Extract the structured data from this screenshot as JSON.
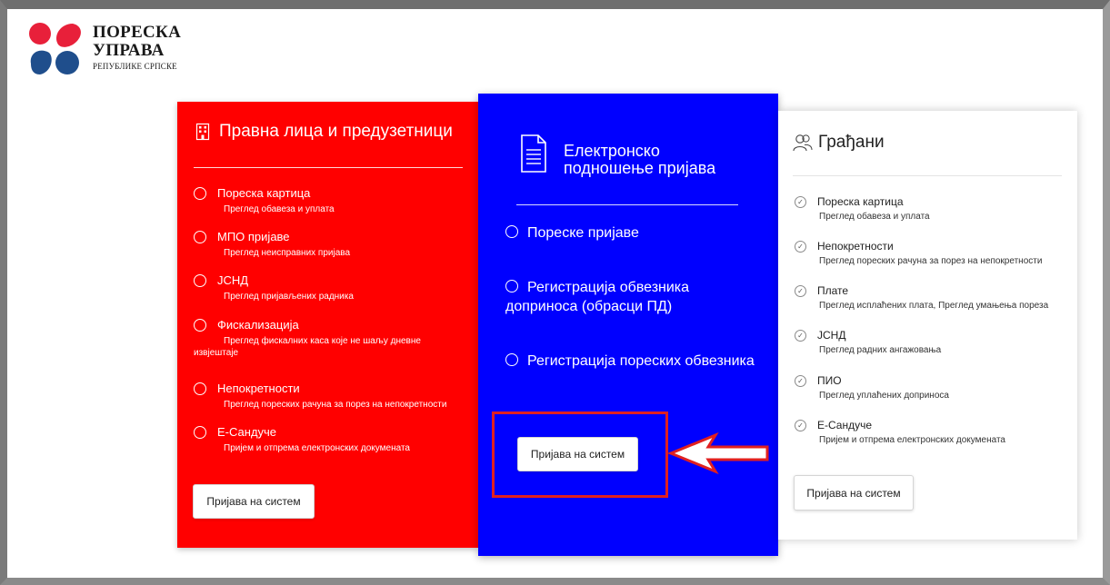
{
  "logo": {
    "line1": "ПОРЕСКА",
    "line2": "УПРАВА",
    "line3": "РЕПУБЛИКЕ СРПСКЕ"
  },
  "legal": {
    "title": "Правна лица и предузетници",
    "items": [
      {
        "label": "Пореска картица",
        "sub": "Преглед обавеза и уплата"
      },
      {
        "label": "МПО пријаве",
        "sub": "Преглед неисправних пријава"
      },
      {
        "label": "ЈСНД",
        "sub": "Преглед пријављених радника"
      },
      {
        "label": "Фискализација",
        "sub": "Преглед фискалних каса које не шаљу дневне извјештаје"
      },
      {
        "label": "Непокретности",
        "sub": "Преглед пореских рачуна за порез на непокретности"
      },
      {
        "label": "Е-Сандуче",
        "sub": "Пријем и отпрема електронских докумената"
      }
    ],
    "login": "Пријава на систем"
  },
  "electronic": {
    "title_line1": "Електронско",
    "title_line2": "подношење пријава",
    "items": [
      {
        "label": "Пореске пријаве"
      },
      {
        "label": "Регистрација обвезника доприноса (обрасци ПД)"
      },
      {
        "label": "Регистрација пореских обвезника"
      }
    ],
    "login": "Пријава на систем"
  },
  "citizens": {
    "title": "Грађани",
    "items": [
      {
        "label": "Пореска картица",
        "sub": "Преглед обавеза и уплата"
      },
      {
        "label": "Непокретности",
        "sub": "Преглед пореских рачуна за порез на непокретности"
      },
      {
        "label": "Плате",
        "sub": "Преглед исплаћених плата, Преглед умањења пореза"
      },
      {
        "label": "ЈСНД",
        "sub": "Преглед радних ангажовања"
      },
      {
        "label": "ПИО",
        "sub": "Преглед уплаћених доприноса"
      },
      {
        "label": "Е-Сандуче",
        "sub": "Пријем и отпрема електронских докумената"
      }
    ],
    "login": "Пријава на систем"
  },
  "colors": {
    "red_card": "#ff0000",
    "blue_card": "#0000ff",
    "highlight": "#e02020"
  }
}
